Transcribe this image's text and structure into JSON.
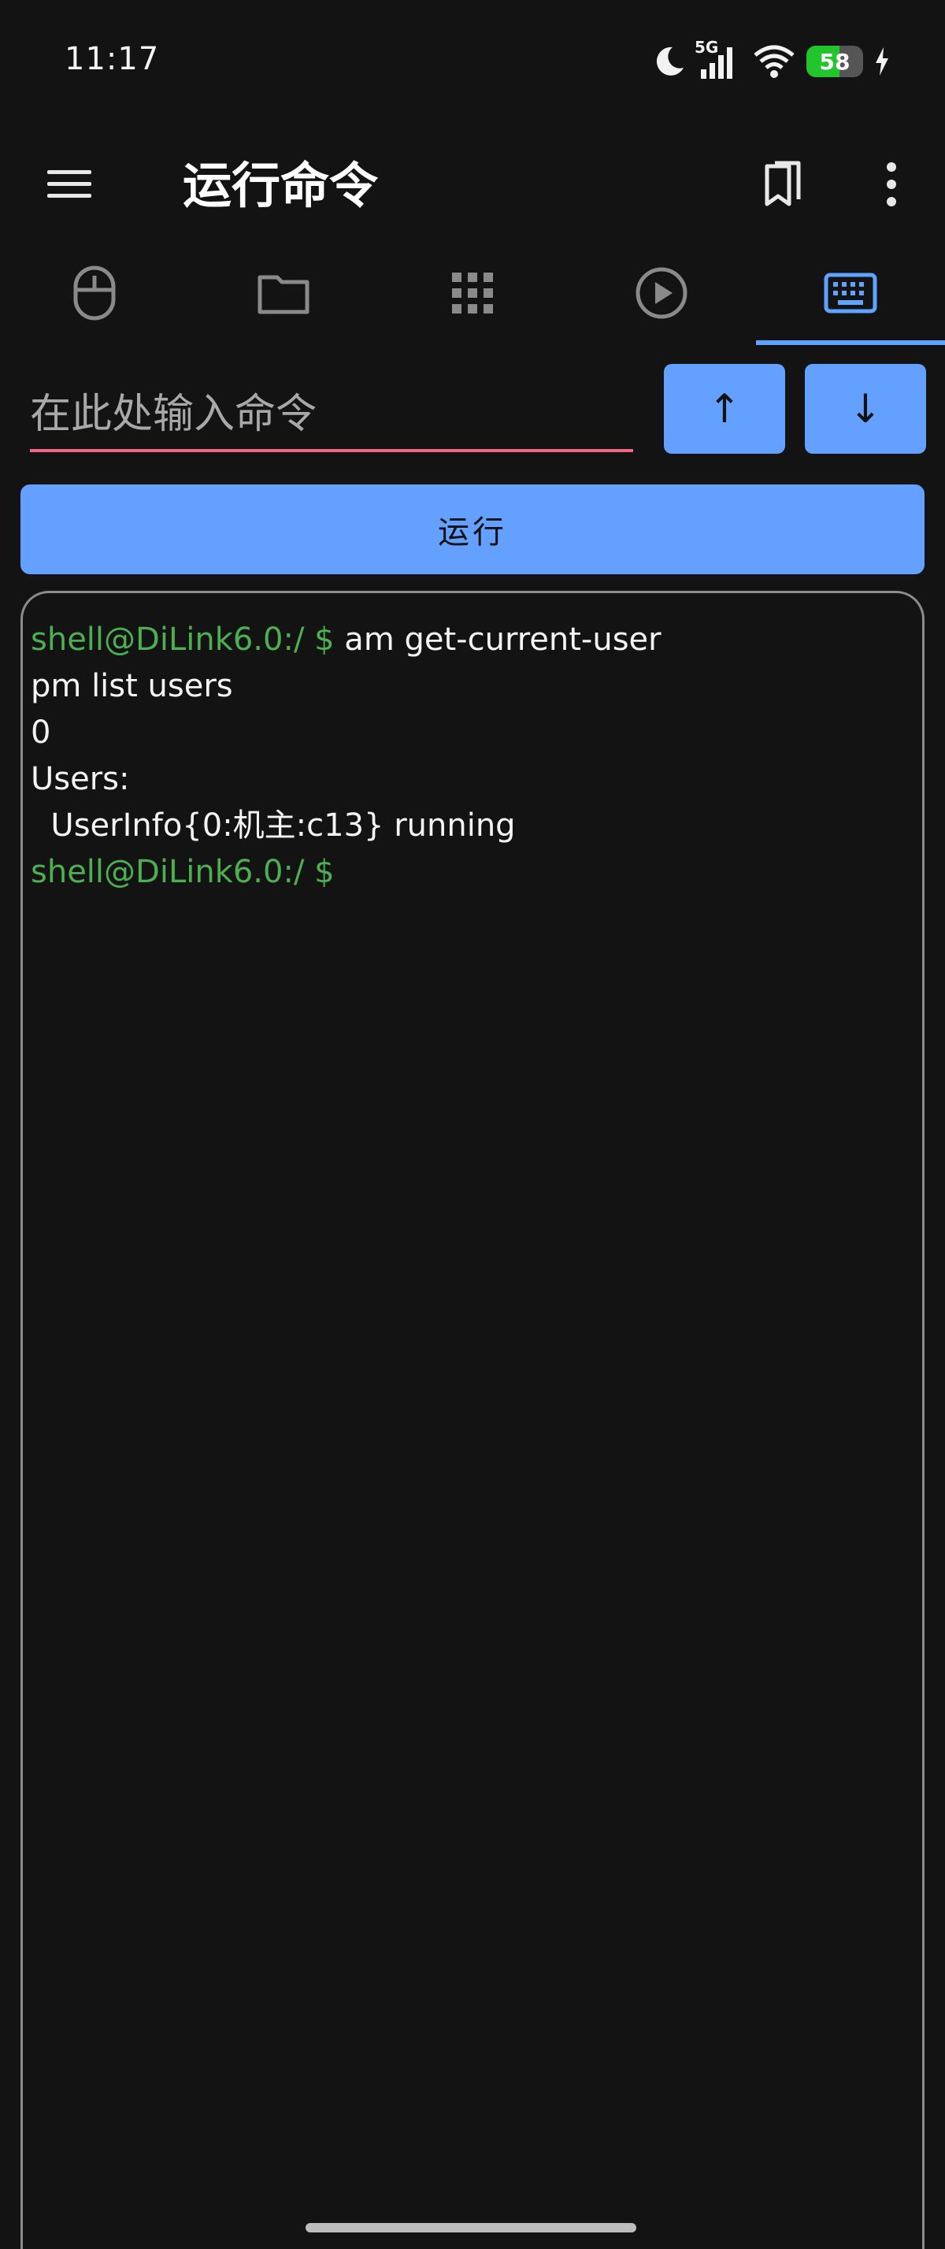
{
  "status_bar": {
    "time": "11:17",
    "network_label": "5G",
    "battery_level": "58",
    "battery_fraction": 0.58,
    "battery_color": "#22c52e",
    "icons": [
      "moon-icon",
      "signal-icon",
      "wifi-icon",
      "battery-icon",
      "charging-icon"
    ]
  },
  "app_bar": {
    "title": "运行命令",
    "left_icon": "menu-icon",
    "right_icons": [
      "bookmark-icon",
      "more-vert-icon"
    ]
  },
  "tabs": [
    {
      "icon": "mouse-icon",
      "active": false
    },
    {
      "icon": "folder-icon",
      "active": false
    },
    {
      "icon": "apps-grid-icon",
      "active": false
    },
    {
      "icon": "play-circle-icon",
      "active": false
    },
    {
      "icon": "keyboard-icon",
      "active": true
    }
  ],
  "command": {
    "placeholder": "在此处输入命令",
    "value": "",
    "history_up": "↑",
    "history_down": "↓",
    "run_label": "运行"
  },
  "terminal": {
    "prompt": "shell@DiLink6.0:/ $",
    "lines": [
      {
        "prompt": "shell@DiLink6.0:/ $",
        "text": " am get-current-user"
      },
      {
        "prompt": "",
        "text": "pm list users"
      },
      {
        "prompt": "",
        "text": "0"
      },
      {
        "prompt": "",
        "text": "Users:"
      },
      {
        "prompt": "",
        "text": "  UserInfo{0:机主:c13} running"
      },
      {
        "prompt": "shell@DiLink6.0:/ $",
        "text": ""
      }
    ]
  },
  "colors": {
    "accent": "#64a0ff",
    "tab_indicator": "#5ea3ff",
    "input_underline": "#f06686",
    "prompt_green": "#4caf50",
    "background": "#131313"
  }
}
